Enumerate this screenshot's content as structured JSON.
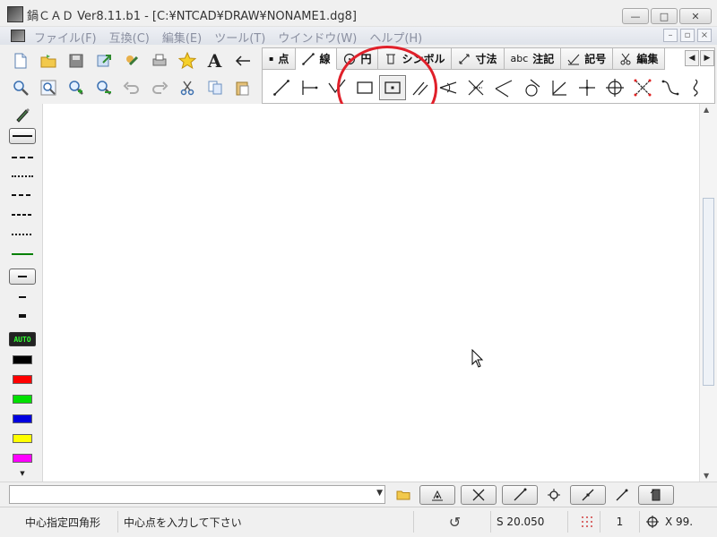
{
  "window": {
    "title": "鍋ＣＡＤ Ver8.11.b1 - [C:¥NTCAD¥DRAW¥NONAME1.dg8]",
    "minimize": "—",
    "maximize": "□",
    "close": "✕"
  },
  "menu": {
    "items": [
      "ファイル(F)",
      "互換(C)",
      "編集(E)",
      "ツール(T)",
      "ウインドウ(W)",
      "ヘルプ(H)"
    ],
    "mdi_buttons": [
      "–",
      "▫",
      "×"
    ]
  },
  "toolbar": {
    "row1": [
      "new-icon",
      "open-icon",
      "save-icon",
      "export-icon",
      "edit-icon",
      "print-icon",
      "star-icon",
      "text-A-icon",
      "arrow-left-icon"
    ],
    "row2": [
      "zoom-window-icon",
      "zoom-all-icon",
      "zoom-in-icon",
      "zoom-out-icon",
      "undo-icon",
      "redo-icon",
      "cut-icon",
      "copy-icon",
      "paste-icon"
    ],
    "text_glyph": "A"
  },
  "tab_panel": {
    "tabs": [
      {
        "label": "点",
        "icon": "point-icon"
      },
      {
        "label": "線",
        "icon": "line-icon",
        "active": true
      },
      {
        "label": "円",
        "icon": "circle-icon"
      },
      {
        "label": "シンボル",
        "icon": "symbol-icon"
      },
      {
        "label": "寸法",
        "icon": "dimension-icon"
      },
      {
        "label": "注記",
        "icon": "note-icon",
        "prefix": "abc"
      },
      {
        "label": "記号",
        "icon": "mark-icon"
      },
      {
        "label": "編集",
        "icon": "edit-tab-icon"
      }
    ],
    "tools": [
      {
        "name": "line-tool"
      },
      {
        "name": "continuous-line-tool"
      },
      {
        "name": "polyline-tool"
      },
      {
        "name": "rectangle-tool"
      },
      {
        "name": "center-rectangle-tool",
        "selected": true
      },
      {
        "name": "parallel-line-tool"
      },
      {
        "name": "tangent-line-tool"
      },
      {
        "name": "bisector-tool"
      },
      {
        "name": "angle-line-tool"
      },
      {
        "name": "circle-tangent-tool"
      },
      {
        "name": "perpendicular-tool"
      },
      {
        "name": "crosshair-tool"
      },
      {
        "name": "target-tool"
      },
      {
        "name": "intersection-tool"
      },
      {
        "name": "curve-tool"
      },
      {
        "name": "spline-tool"
      }
    ]
  },
  "left_palette": {
    "auto_label": "AUTO",
    "colors": [
      "#000000",
      "#ff0000",
      "#00e000",
      "#0000e0",
      "#ffff00",
      "#ff00ff"
    ],
    "line_green": "#008000"
  },
  "command": {
    "value": "",
    "placeholder": ""
  },
  "status": {
    "mode": "中心指定四角形",
    "prompt": "中心点を入力して下さい",
    "scale": "S 20.050",
    "layer": "1",
    "coord": "X 99."
  },
  "annotation_color": "#e0202a"
}
